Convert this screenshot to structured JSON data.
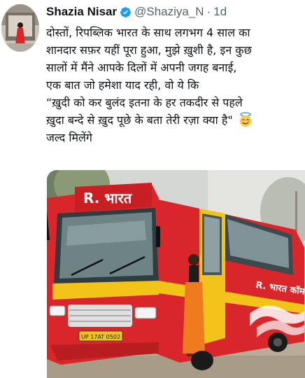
{
  "user": {
    "display_name": "Shazia Nisar",
    "handle": "@Shaziya_N",
    "separator": "·",
    "time": "1d",
    "verified": true
  },
  "tweet": {
    "lines": [
      "दोस्तों, रिपब्लिक भारत के साथ लगभग 4 साल का",
      "शानदार सफ़र यहीं पूरा हुआ, मुझे ख़ुशी है, इन कुछ",
      "सालों में मैंने आपके दिलों में अपनी जगह बनाई,",
      "एक बात जो हमेशा याद रही, वो ये कि",
      "“ख़ुदी को कर बुलंद इतना के हर तकदीर से पहले",
      "ख़ुदा बन्दे से ख़ुद पूछे के बता तेरी रज़ा क्या है\"",
      "जल्द मिलेंगे"
    ],
    "emoji": "smiling-face-with-halo-icon"
  },
  "media": {
    "bus_front_sign": "R. भारत",
    "bus_side_text": "R. भारत कॉम",
    "license_plate": "UP 17AT 0502"
  },
  "colors": {
    "verified": "#1d9bf0",
    "name": "#0f1419",
    "secondary": "#536471",
    "bus_red": "#e0262b",
    "bus_yellow": "#f2c318"
  }
}
